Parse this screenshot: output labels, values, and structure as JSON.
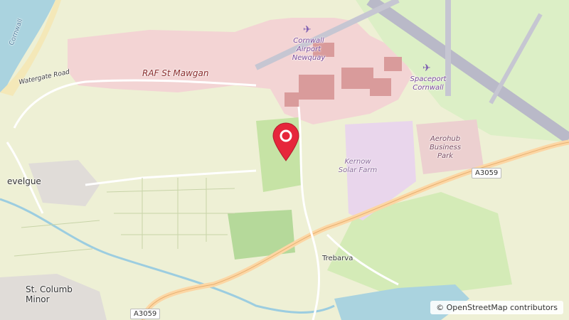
{
  "map": {
    "labels": {
      "raf": "RAF St Mawgan",
      "airport": "Cornwall\nAirport\nNewquay",
      "spaceport": "Spaceport\nCornwall",
      "aerohub": "Aerohub\nBusiness\nPark",
      "solar_farm": "Kernow\nSolar Farm",
      "trebarva": "Trebarva",
      "st_columb": "St. Columb\nMinor",
      "evelgue": "evelgue",
      "watergate": "Watergate Road",
      "cornwall_coast": "Cornwall"
    },
    "roads": {
      "a3059_east": "A3059",
      "a3059_west": "A3059"
    },
    "icons": {
      "airport": "plane-icon",
      "spaceport": "plane-icon",
      "marker": "map-pin-icon"
    },
    "attribution": "© OpenStreetMap contributors"
  }
}
